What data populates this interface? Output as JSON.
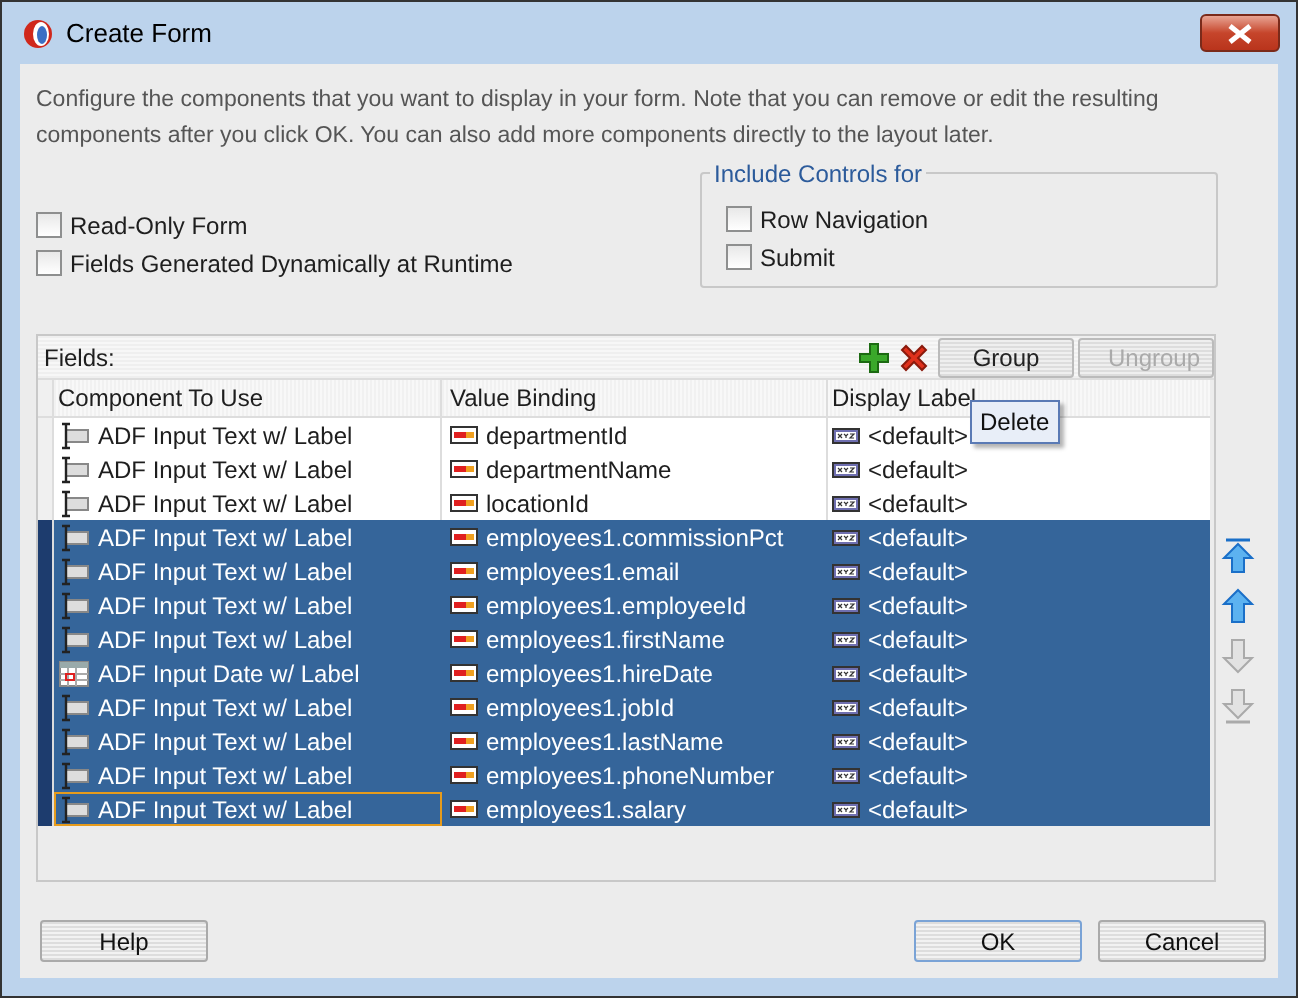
{
  "window": {
    "title": "Create Form"
  },
  "description": "Configure the components that you want to display in your form. Note that you can remove or edit the resulting components after you click OK. You can also add more components directly to the layout later.",
  "options": [
    {
      "label": "Read-Only Form",
      "checked": false
    },
    {
      "label": "Fields Generated Dynamically at Runtime",
      "checked": false
    }
  ],
  "include_controls": {
    "title": "Include Controls for",
    "options": [
      {
        "label": "Row Navigation",
        "checked": false
      },
      {
        "label": "Submit",
        "checked": false
      }
    ]
  },
  "fields": {
    "title": "Fields:",
    "toolbar": [
      {
        "kind": "add"
      },
      {
        "kind": "delete"
      },
      {
        "kind": "button",
        "label": "Group",
        "disabled": false
      },
      {
        "kind": "button",
        "label": "Ungroup",
        "disabled": true
      }
    ],
    "tooltip": "Delete",
    "columns": [
      "Component To Use",
      "Value Binding",
      "Display Label"
    ],
    "rows": [
      {
        "component": "ADF Input Text w/ Label",
        "kind": "text",
        "binding": "departmentId",
        "label": "<default>",
        "selected": false,
        "focused": false
      },
      {
        "component": "ADF Input Text w/ Label",
        "kind": "text",
        "binding": "departmentName",
        "label": "<default>",
        "selected": false,
        "focused": false
      },
      {
        "component": "ADF Input Text w/ Label",
        "kind": "text",
        "binding": "locationId",
        "label": "<default>",
        "selected": false,
        "focused": false
      },
      {
        "component": "ADF Input Text w/ Label",
        "kind": "text",
        "binding": "employees1.commissionPct",
        "label": "<default>",
        "selected": true,
        "focused": false
      },
      {
        "component": "ADF Input Text w/ Label",
        "kind": "text",
        "binding": "employees1.email",
        "label": "<default>",
        "selected": true,
        "focused": false
      },
      {
        "component": "ADF Input Text w/ Label",
        "kind": "text",
        "binding": "employees1.employeeId",
        "label": "<default>",
        "selected": true,
        "focused": false
      },
      {
        "component": "ADF Input Text w/ Label",
        "kind": "text",
        "binding": "employees1.firstName",
        "label": "<default>",
        "selected": true,
        "focused": false
      },
      {
        "component": "ADF Input Date w/ Label",
        "kind": "date",
        "binding": "employees1.hireDate",
        "label": "<default>",
        "selected": true,
        "focused": false
      },
      {
        "component": "ADF Input Text w/ Label",
        "kind": "text",
        "binding": "employees1.jobId",
        "label": "<default>",
        "selected": true,
        "focused": false
      },
      {
        "component": "ADF Input Text w/ Label",
        "kind": "text",
        "binding": "employees1.lastName",
        "label": "<default>",
        "selected": true,
        "focused": false
      },
      {
        "component": "ADF Input Text w/ Label",
        "kind": "text",
        "binding": "employees1.phoneNumber",
        "label": "<default>",
        "selected": true,
        "focused": false
      },
      {
        "component": "ADF Input Text w/ Label",
        "kind": "text",
        "binding": "employees1.salary",
        "label": "<default>",
        "selected": true,
        "focused": true
      }
    ]
  },
  "move_buttons": [
    {
      "kind": "top",
      "disabled": false
    },
    {
      "kind": "up",
      "disabled": false
    },
    {
      "kind": "down",
      "disabled": true
    },
    {
      "kind": "bottom",
      "disabled": true
    }
  ],
  "buttons": [
    {
      "label": "Help",
      "default": false
    },
    {
      "label": "OK",
      "default": true
    },
    {
      "label": "Cancel",
      "default": false
    }
  ]
}
